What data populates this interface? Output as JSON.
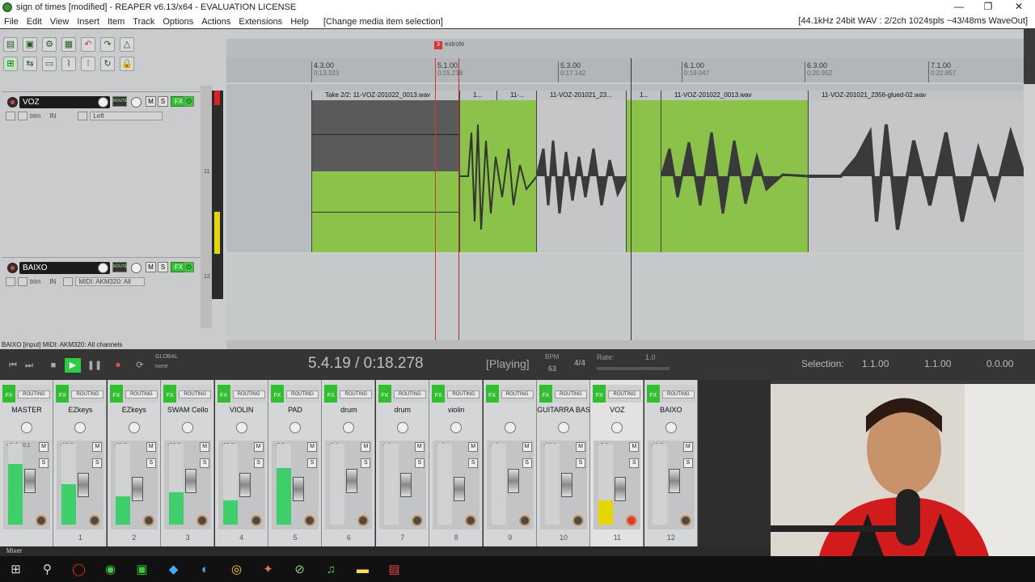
{
  "window": {
    "title": "sign of times [modified] - REAPER v6.13/x64 - EVALUATION LICENSE",
    "minimize": "—",
    "restore": "❐",
    "close": "✕"
  },
  "menu": {
    "items": [
      "File",
      "Edit",
      "View",
      "Insert",
      "Item",
      "Track",
      "Options",
      "Actions",
      "Extensions",
      "Help",
      "[Change media item selection]"
    ],
    "status": "[44.1kHz 24bit WAV : 2/2ch 1024spls ~43/48ms WaveOut]"
  },
  "marker": {
    "num": "3",
    "label": "estrofe"
  },
  "ruler": [
    {
      "bar": "4.3.00",
      "time": "0:13.333"
    },
    {
      "bar": "5.1.00",
      "time": "0:15.238"
    },
    {
      "bar": "5.3.00",
      "time": "0:17.142"
    },
    {
      "bar": "6.1.00",
      "time": "0:19.047"
    },
    {
      "bar": "6.3.00",
      "time": "0:20.952"
    },
    {
      "bar": "7.1.00",
      "time": "0:22.857"
    }
  ],
  "tracks": [
    {
      "name": "VOZ",
      "input": "Left",
      "trim": "trim",
      "in": "IN",
      "num": "11"
    },
    {
      "name": "BAIXO",
      "input": "MIDI: AKM320: All",
      "trim": "trim",
      "in": "IN",
      "num": "12"
    }
  ],
  "track_buttons": {
    "m": "M",
    "s": "S",
    "fx": "FX",
    "route": "ROUTE"
  },
  "items": [
    {
      "label": "Take 2/2: 11-VOZ-201022_0013.wav"
    },
    {
      "label": "1..."
    },
    {
      "label": "11-..."
    },
    {
      "label": "11-VOZ-201021_23..."
    },
    {
      "label": "1..."
    },
    {
      "label": "11-VOZ-201022_0013.wav"
    },
    {
      "label": "11-VOZ-201021_2356-glued-02.wav"
    }
  ],
  "status_line": "BAIXO [input] MIDI: AKM320: All channels",
  "transport": {
    "time": "5.4.19 / 0:18.278",
    "state": "[Playing]",
    "bpm_label": "BPM",
    "bpm": "63",
    "sig": "4/4",
    "rate_label": "Rate:",
    "rate": "1.0",
    "global": "GLOBAL",
    "none": "none",
    "selection_label": "Selection:",
    "sel_start": "1.1.00",
    "sel_end": "1.1.00",
    "sel_len": "0.0.00"
  },
  "mixer": {
    "strips": [
      {
        "name": "MASTER",
        "num": "",
        "peak": "+0.4 +0.1",
        "level": 0.75,
        "fx": "FX",
        "routing": "ROUTING"
      },
      {
        "name": "EZkeys",
        "num": "1",
        "peak": "-10.7",
        "level": 0.5,
        "fx": "FX",
        "routing": "ROUTING"
      },
      {
        "name": "EZkeys",
        "num": "2",
        "peak": "-15.0",
        "level": 0.35,
        "fx": "FX",
        "routing": "ROUTING"
      },
      {
        "name": "SWAM Cello",
        "num": "3",
        "peak": "-26.7",
        "level": 0.4,
        "fx": "FX",
        "routing": "ROUTING"
      },
      {
        "name": "VIOLIN",
        "num": "4",
        "peak": "-33.6",
        "level": 0.3,
        "fx": "FX",
        "routing": "ROUTING"
      },
      {
        "name": "PAD",
        "num": "5",
        "peak": "-9.2",
        "level": 0.7,
        "fx": "FX",
        "routing": "ROUTING"
      },
      {
        "name": "drum",
        "num": "6",
        "peak": "-3.4",
        "level": 0.0,
        "fx": "FX",
        "routing": "ROUTING"
      },
      {
        "name": "drum",
        "num": "7",
        "peak": "-inf",
        "level": 0.0,
        "fx": "FX",
        "routing": "ROUTING"
      },
      {
        "name": "violin",
        "num": "8",
        "peak": "-inf",
        "level": 0.0,
        "fx": "FX",
        "routing": "ROUTING"
      },
      {
        "name": "",
        "num": "9",
        "peak": "-inf",
        "level": 0.0,
        "fx": "FX",
        "routing": "ROUTING"
      },
      {
        "name": "GUITARRA BAS",
        "num": "10",
        "peak": "-10.1",
        "level": 0.0,
        "fx": "FX",
        "routing": "ROUTING"
      },
      {
        "name": "VOZ",
        "num": "11",
        "peak": "+0.0",
        "level": 0.3,
        "fx": "FX",
        "routing": "ROUTING"
      },
      {
        "name": "BAIXO",
        "num": "12",
        "peak": "-11.8",
        "level": 0.0,
        "fx": "FX",
        "routing": "ROUTING"
      }
    ],
    "m": "M",
    "s": "S"
  },
  "mixer_tab": "Mixer"
}
